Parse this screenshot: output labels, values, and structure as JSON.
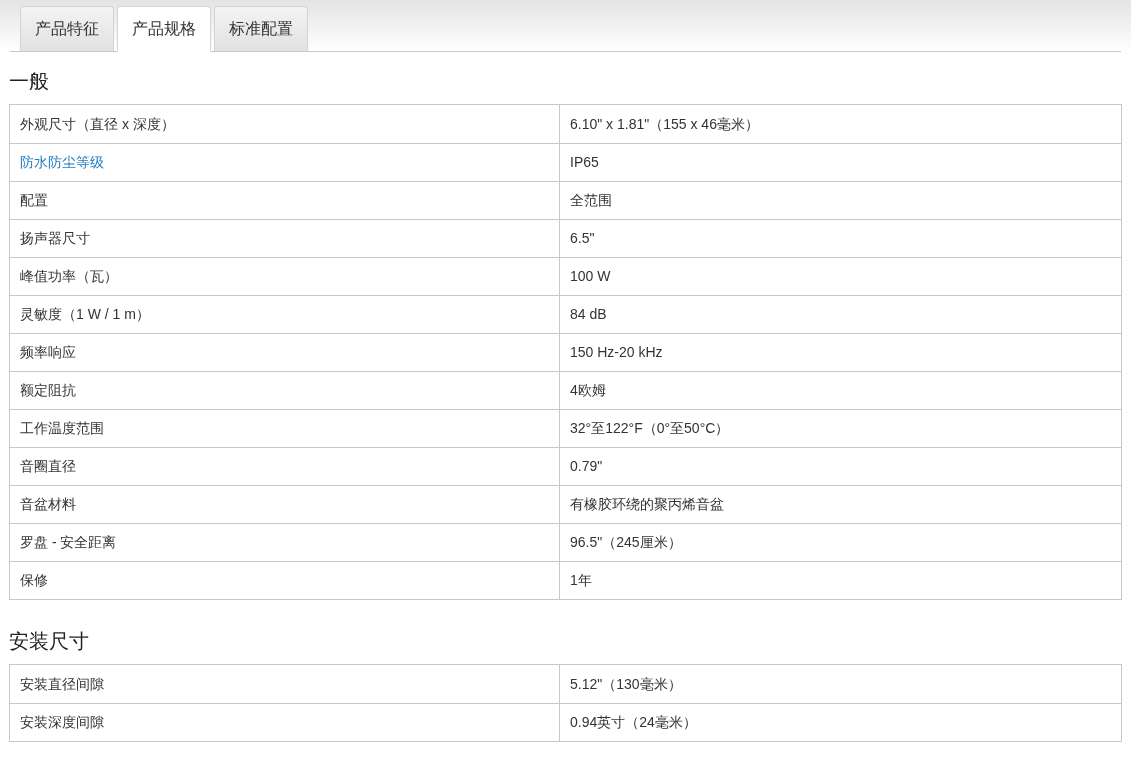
{
  "tabs": [
    {
      "label": "产品特征",
      "selected": false
    },
    {
      "label": "产品规格",
      "selected": true
    },
    {
      "label": "标准配置",
      "selected": false
    }
  ],
  "sections": [
    {
      "title": "一般",
      "rows": [
        {
          "label": "外观尺寸（直径 x 深度）",
          "value": "6.10\" x 1.81\"（155 x 46毫米）",
          "kind": "text"
        },
        {
          "label": "防水防尘等级",
          "value": "IP65",
          "kind": "link"
        },
        {
          "label": "配置",
          "value": "全范围",
          "kind": "text"
        },
        {
          "label": "扬声器尺寸",
          "value": "6.5\"",
          "kind": "text"
        },
        {
          "label": "峰值功率（瓦）",
          "value": "100 W",
          "kind": "text"
        },
        {
          "label": "灵敏度（1 W / 1 m）",
          "value": "84 dB",
          "kind": "text"
        },
        {
          "label": "频率响应",
          "value": "150 Hz-20 kHz",
          "kind": "text"
        },
        {
          "label": "额定阻抗",
          "value": "4欧姆",
          "kind": "text"
        },
        {
          "label": "工作温度范围",
          "value": "32°至122°F（0°至50°C）",
          "kind": "text"
        },
        {
          "label": "音圈直径",
          "value": "0.79\"",
          "kind": "text"
        },
        {
          "label": "音盆材料",
          "value": "有橡胶环绕的聚丙烯音盆",
          "kind": "text"
        },
        {
          "label": "罗盘 - 安全距离",
          "value": "96.5\"（245厘米）",
          "kind": "text"
        },
        {
          "label": "保修",
          "value": "1年",
          "kind": "text"
        }
      ]
    },
    {
      "title": "安装尺寸",
      "rows": [
        {
          "label": "安装直径间隙",
          "value": "5.12\"（130毫米）",
          "kind": "text"
        },
        {
          "label": "安装深度间隙",
          "value": "0.94英寸（24毫米）",
          "kind": "text"
        }
      ]
    }
  ]
}
